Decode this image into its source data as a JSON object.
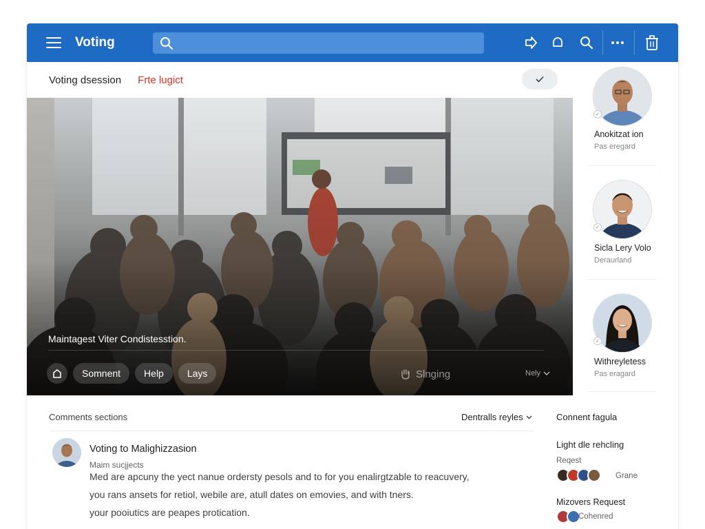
{
  "app": {
    "title": "Voting"
  },
  "search": {
    "placeholder": ""
  },
  "toolbar": {
    "icons": [
      "share-icon",
      "bell-icon",
      "search-icon",
      "more-icon",
      "trash-icon"
    ]
  },
  "subheader": {
    "title": "Voting dsession",
    "tag": "Frte lugict"
  },
  "media": {
    "caption": "Maintagest Viter Condistesstion.",
    "chips": [
      "Somnent",
      "Help",
      "Lays"
    ],
    "staging": "Slnging",
    "more": "Nely"
  },
  "people": [
    {
      "name": "Anokitzat ion",
      "sub": "Pas eregard"
    },
    {
      "name": "Sicla Lery Volo",
      "sub": "Deraurland"
    },
    {
      "name": "Withreyletess",
      "sub": "Pas eragard"
    }
  ],
  "comments": {
    "heading": "Comments sections",
    "sort": "Dentralls reyles",
    "item": {
      "title": "Voting to Malighizzasion",
      "subtitle": "Maim sucjjects",
      "lines": [
        "Med are apcuny the yect nanue ordersty pesols and to for you enalirgtzable to reacuvery,",
        "you rans ansets for retiol, webile are, atull dates on emovies, and with tners.",
        "your pooiutics are peapes protication."
      ]
    }
  },
  "side_panel": {
    "heading": "Connent fagula",
    "item1": {
      "title": "Light dle rehcling",
      "sub": "Reqest",
      "group": "Grane"
    },
    "item2": {
      "title": "Mizovers Request",
      "sub": "Cohenred"
    }
  },
  "colors": {
    "brand": "#1f6bc4",
    "tag": "#d93025"
  }
}
